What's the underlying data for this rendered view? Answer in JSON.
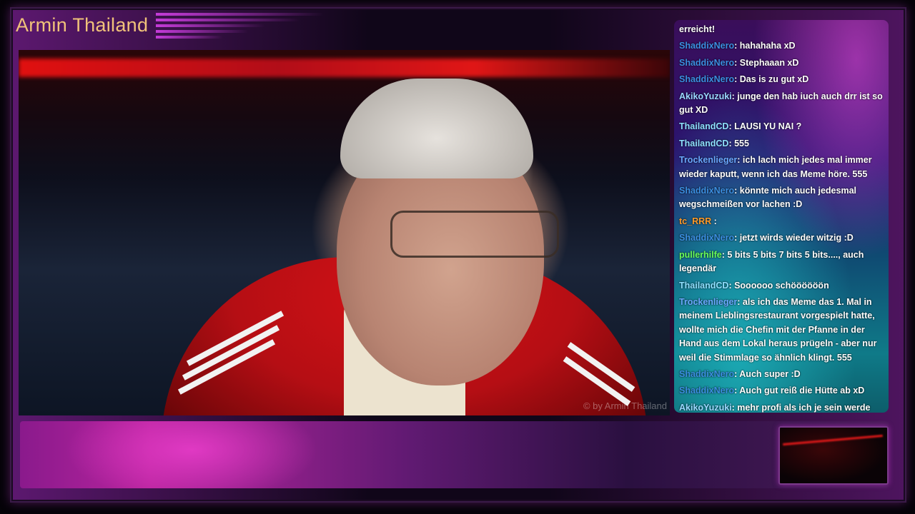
{
  "stream": {
    "title": "Armin Thailand",
    "watermark": "© by Armin Thailand"
  },
  "colors": {
    "title": "#f0c27a",
    "accent": "#c43bd8"
  },
  "chat": {
    "messages": [
      {
        "user": "",
        "color": "#ffffff",
        "text": "erreicht!"
      },
      {
        "user": "ShaddixNero",
        "color": "#3b8ee0",
        "text": ": hahahaha xD"
      },
      {
        "user": "ShaddixNero",
        "color": "#3b8ee0",
        "text": ": Stephaaan xD"
      },
      {
        "user": "ShaddixNero",
        "color": "#3b8ee0",
        "text": ": Das is zu gut xD"
      },
      {
        "user": "AkikoYuzuki",
        "color": "#9ad8ff",
        "text": ": junge den hab iuch auch drr ist so gut XD"
      },
      {
        "user": "ThailandCD",
        "color": "#8ee0ff",
        "text": ": LAUSI YU NAI ?"
      },
      {
        "user": "ThailandCD",
        "color": "#8ee0ff",
        "text": ": 555"
      },
      {
        "user": "Trockenlieger",
        "color": "#6aa8ff",
        "text": ": ich lach mich jedes mal immer wieder kaputt, wenn ich das Meme höre. 555"
      },
      {
        "user": "ShaddixNero",
        "color": "#3b8ee0",
        "text": ": könnte mich auch jedesmal wegschmeißen vor lachen :D"
      },
      {
        "user": "tc_RRR",
        "color": "#ff9a2a",
        "text": " :"
      },
      {
        "user": "ShaddixNero",
        "color": "#3b8ee0",
        "text": ": jetzt wirds wieder witzig :D"
      },
      {
        "user": "pullerhilfe",
        "color": "#6aff5a",
        "text": ": 5 bits 5 bits 7 bits 5 bits...., auch legendär"
      },
      {
        "user": "ThailandCD",
        "color": "#8ee0ff",
        "text": ": Soooooo schöööööön"
      },
      {
        "user": "Trockenlieger",
        "color": "#6aa8ff",
        "text": ": als ich das Meme das 1. Mal in meinem Lieblingsrestaurant vorgespielt hatte, wollte mich die Chefin mit der Pfanne in der Hand aus dem Lokal heraus prügeln - aber nur weil die Stimmlage so ähnlich klingt. 555"
      },
      {
        "user": "ShaddixNero",
        "color": "#3b8ee0",
        "text": ": Auch super :D"
      },
      {
        "user": "ShaddixNero",
        "color": "#3b8ee0",
        "text": ": Auch gut reiß die Hütte ab xD"
      },
      {
        "user": "AkikoYuzuki",
        "color": "#9ad8ff",
        "text": ": mehr profi als ich je sein werde"
      }
    ]
  }
}
